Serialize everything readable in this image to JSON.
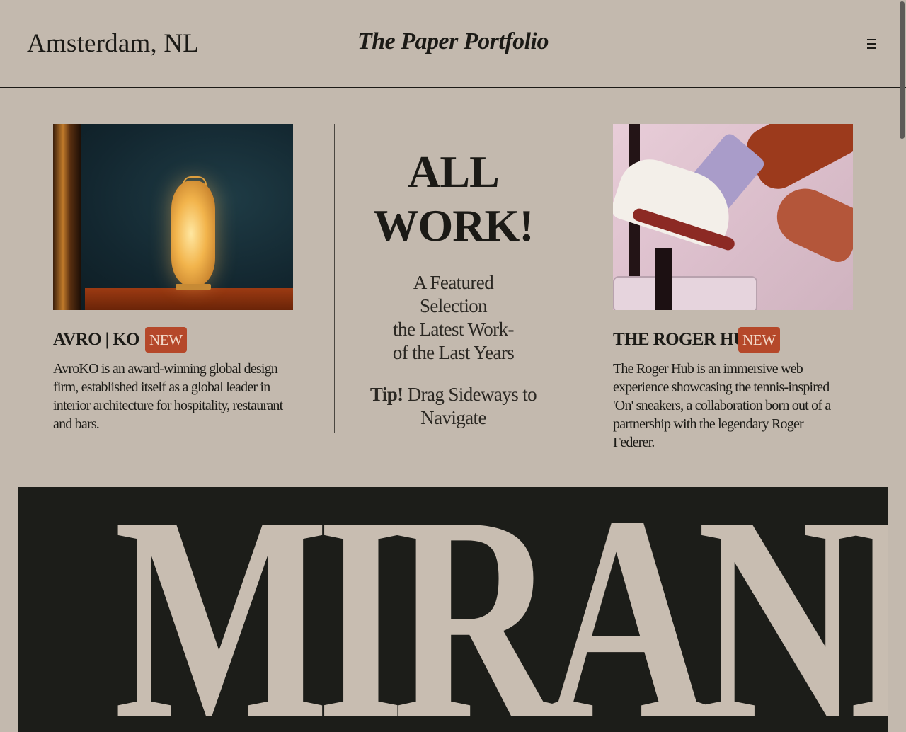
{
  "header": {
    "location": "Amsterdam, NL",
    "brand": "The Paper Portfolio",
    "menu_icon": "hamburger-menu-icon"
  },
  "cards": [
    {
      "title": "AVRO | KO",
      "badge": "NEW",
      "description": "AvroKO is an award-winning global design firm, established itself as a global leader in interior architecture for hospitality, restaurant and bars."
    },
    {
      "title": "THE ROGER HUB",
      "badge": "NEW",
      "description": "The Roger Hub is an immersive web experience showcasing the tennis-inspired 'On' sneakers, a collaboration born out of a partnership with the legendary Roger Federer."
    }
  ],
  "center": {
    "headline_line1": "ALL",
    "headline_line2": "WORK!",
    "subtitle_line1": "A Featured",
    "subtitle_line2": "Selection",
    "subtitle_line3": "the Latest Work-",
    "subtitle_line4": "of the Last Years",
    "tip_label": "Tip!",
    "tip_text_line1": "Drag Sideways to",
    "tip_text_line2": "Navigate"
  },
  "banner": {
    "text": "MIRANDA"
  },
  "colors": {
    "background": "#c3b9ae",
    "text": "#1b1a16",
    "badge": "#b5482a",
    "banner": "#1c1d19"
  }
}
